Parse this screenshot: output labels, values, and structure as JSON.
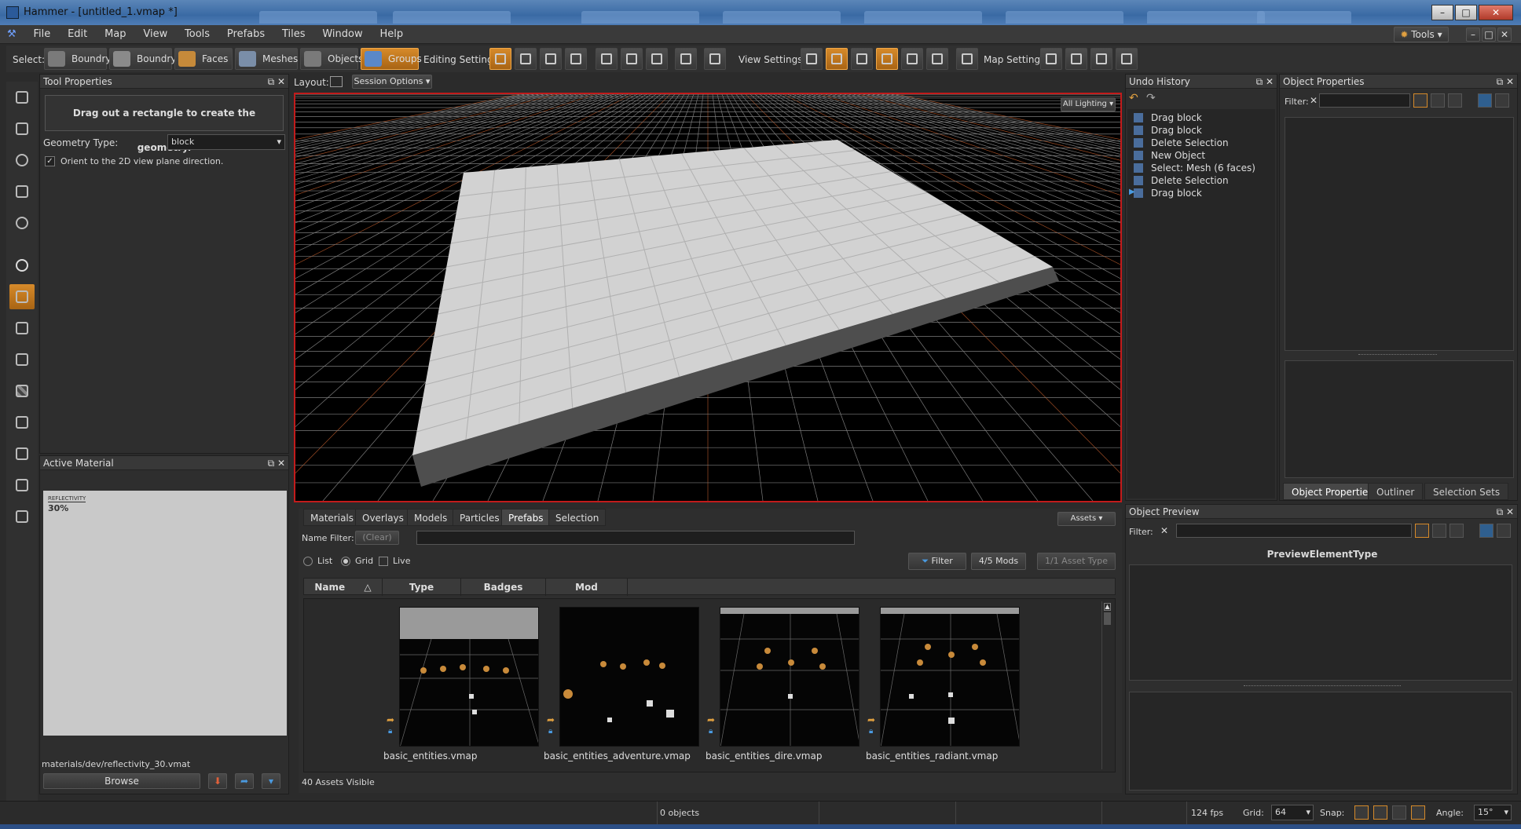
{
  "window": {
    "title": "Hammer - [untitled_1.vmap *]",
    "controls": [
      "–",
      "□",
      "✕"
    ]
  },
  "menu": [
    "File",
    "Edit",
    "Map",
    "View",
    "Tools",
    "Prefabs",
    "Tiles",
    "Window",
    "Help"
  ],
  "topright": {
    "tools_label": "Tools",
    "controls": [
      "–",
      "□",
      "✕"
    ]
  },
  "toolbar": {
    "select_label": "Select:",
    "select_buttons": [
      "Boundry",
      "Boundry",
      "Faces",
      "Meshes",
      "Objects",
      "Groups"
    ],
    "active_select": "Groups",
    "editing_label": "Editing Settings:",
    "view_label": "View Settings:",
    "map_label": "Map Settings:"
  },
  "left_tools": [
    "select-tool",
    "move-tool",
    "rotate-tool",
    "scale-tool",
    "pivot-tool",
    "light-tool",
    "block-tool",
    "clip-tool",
    "vertex-tool",
    "texture-tool",
    "paint-tool",
    "tile-tool",
    "foliage-tool",
    "path-tool"
  ],
  "tool_properties": {
    "title": "Tool Properties",
    "hint": "Drag out a rectangle to create the geometry.",
    "geometry_label": "Geometry Type:",
    "geometry_value": "block",
    "orient_label": "Orient to the 2D view plane direction.",
    "orient_checked": true
  },
  "active_material": {
    "title": "Active Material",
    "preview_title": "REFLECTIVITY",
    "preview_value": "30%",
    "path": "materials/dev/reflectivity_30.vmat",
    "browse_label": "Browse"
  },
  "viewport": {
    "layout_label": "Layout:",
    "session_options": "Session Options",
    "lighting": "All Lighting"
  },
  "asset_browser": {
    "tabs": [
      "Materials",
      "Overlays",
      "Models",
      "Particles",
      "Prefabs",
      "Selection"
    ],
    "selected_tab": "Prefabs",
    "assets_button": "Assets",
    "name_filter_label": "Name Filter:",
    "clear_label": "(Clear)",
    "view_modes": [
      "List",
      "Grid",
      "Live"
    ],
    "selected_view_mode": "Grid",
    "filter_button": "Filter",
    "mods_button": "4/5 Mods",
    "asset_type_button": "1/1 Asset Type",
    "columns": [
      "Name",
      "Type",
      "Badges",
      "Mod"
    ],
    "items": [
      "basic_entities.vmap",
      "basic_entities_adventure.vmap",
      "basic_entities_dire.vmap",
      "basic_entities_radiant.vmap"
    ],
    "visible_count": "40 Assets Visible"
  },
  "undo_history": {
    "title": "Undo History",
    "items": [
      "Drag block",
      "Drag block",
      "Delete Selection",
      "New Object",
      "Select: Mesh (6 faces)",
      "Delete Selection",
      "Drag block"
    ]
  },
  "object_properties": {
    "title": "Object Properties",
    "filter_label": "Filter:",
    "bottom_tabs": [
      "Object Properties",
      "Outliner",
      "Selection Sets"
    ],
    "selected_tab": "Object Properties"
  },
  "object_preview": {
    "title": "Object Preview",
    "filter_label": "Filter:",
    "element_type": "PreviewElementType"
  },
  "status": {
    "objects": "0 objects",
    "fps": "124 fps",
    "grid_label": "Grid:",
    "grid_value": "64",
    "snap_label": "Snap:",
    "angle_label": "Angle:",
    "angle_value": "15°"
  },
  "colors": {
    "accent_orange": "#d68a2a",
    "viewport_border": "#c21b1b",
    "panel_bg": "#2e2e2e"
  }
}
